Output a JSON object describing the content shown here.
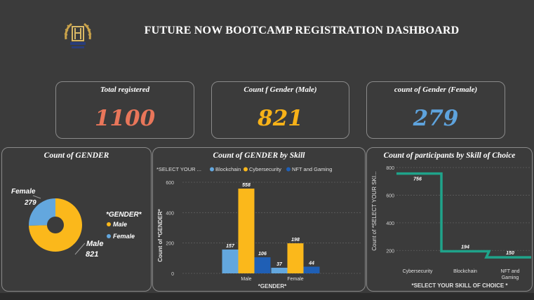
{
  "header": {
    "title": "FUTURE NOW BOOTCAMP REGISTRATION DASHBOARD",
    "logo_icon": "fh-monogram-laurel-logo"
  },
  "kpis": [
    {
      "label": "Total registered",
      "value": "1100",
      "color": "#e9765a"
    },
    {
      "label": "Count f Gender (Male)",
      "value": "821",
      "color": "#f8b218"
    },
    {
      "label": "count of Gender (Female)",
      "value": "279",
      "color": "#5ea3dd"
    }
  ],
  "colors": {
    "background": "#3b3b3b",
    "male": "#fbb81b",
    "female": "#63a7de",
    "blockchain": "#63a7de",
    "cybersecurity": "#fbb81b",
    "nft": "#1f5fb5",
    "line": "#1fa38a"
  },
  "donut": {
    "title": "Count of GENDER",
    "legend_title": "*GENDER*",
    "male_label": "Male",
    "male_value": "821",
    "female_label": "Female",
    "female_value": "279"
  },
  "bar_panel": {
    "title": "Count of GENDER by Skill",
    "legend_title": "*SELECT YOUR ...",
    "ylabel": "Count of *GENDER*",
    "xlabel": "*GENDER*"
  },
  "line_panel": {
    "title": "Count of participants by Skill of Choice",
    "ylabel": "Count of *SELECT YOUR SKI...",
    "xlabel": "*SELECT YOUR SKILL OF CHOICE *"
  },
  "chart_data": [
    {
      "type": "pie",
      "title": "Count of GENDER",
      "legend_title": "*GENDER*",
      "categories": [
        "Male",
        "Female"
      ],
      "values": [
        821,
        279
      ],
      "legend_position": "right"
    },
    {
      "type": "bar",
      "title": "Count of GENDER by Skill",
      "legend_title": "*SELECT YOUR ...",
      "categories": [
        "Male",
        "Female"
      ],
      "series": [
        {
          "name": "Blockchain",
          "values": [
            157,
            37
          ]
        },
        {
          "name": "Cybersecurity",
          "values": [
            558,
            198
          ]
        },
        {
          "name": "NFT and Gaming",
          "values": [
            106,
            44
          ]
        }
      ],
      "yticks": [
        "0",
        "200",
        "400",
        "600"
      ],
      "ylim": [
        0,
        600
      ],
      "xlabel": "*GENDER*",
      "ylabel": "Count of *GENDER*",
      "legend_position": "top",
      "grid": true
    },
    {
      "type": "line",
      "title": "Count of participants by Skill of Choice",
      "x": [
        "Cybersecurity",
        "Blockchain",
        "NFT and Gaming"
      ],
      "values": [
        756,
        194,
        150
      ],
      "yticks": [
        "200",
        "400",
        "600",
        "800"
      ],
      "ylim": [
        100,
        800
      ],
      "xlabel": "*SELECT YOUR SKILL OF CHOICE *",
      "ylabel": "Count of *SELECT YOUR SKI...",
      "grid": true
    }
  ]
}
